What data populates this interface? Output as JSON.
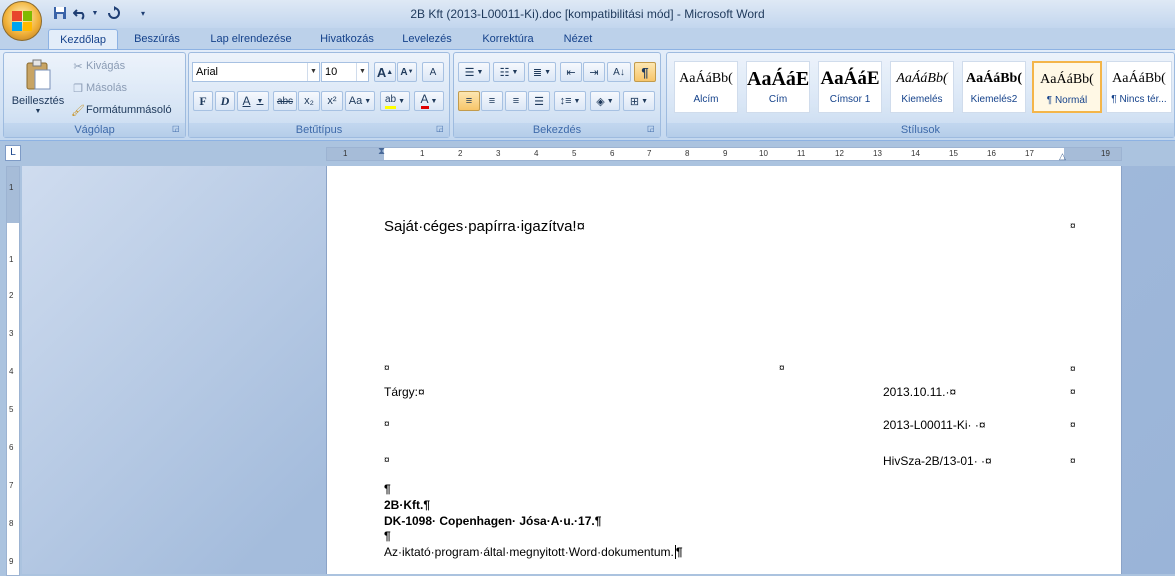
{
  "window": {
    "title": "2B Kft  (2013-L00011-Ki).doc [kompatibilitási mód] - Microsoft Word"
  },
  "qat": {
    "save_icon": "save-icon",
    "undo_icon": "undo-icon",
    "redo_icon": "redo-icon",
    "dropdown_icon": "chevron-down-icon"
  },
  "tabs": [
    {
      "label": "Kezdőlap",
      "active": true
    },
    {
      "label": "Beszúrás"
    },
    {
      "label": "Lap elrendezése"
    },
    {
      "label": "Hivatkozás"
    },
    {
      "label": "Levelezés"
    },
    {
      "label": "Korrektúra"
    },
    {
      "label": "Nézet"
    }
  ],
  "clipboard": {
    "paste": "Beillesztés",
    "cut": "Kivágás",
    "copy": "Másolás",
    "format_painter": "Formátummásoló",
    "group": "Vágólap"
  },
  "font": {
    "name": "Arial",
    "size": "10",
    "grow": "A",
    "shrink": "A",
    "clear": "A",
    "bold": "F",
    "italic": "D",
    "underline": "A",
    "strike": "abc",
    "sub": "x₂",
    "sup": "x²",
    "case": "Aa",
    "highlight": "ab",
    "color": "A",
    "group": "Betűtípus"
  },
  "paragraph": {
    "group": "Bekezdés",
    "pilcrow": "¶"
  },
  "styles": {
    "group": "Stílusok",
    "items": [
      {
        "preview": "AaÁáBb(",
        "name": "Alcím"
      },
      {
        "preview": "AaÁáE",
        "name": "Cím"
      },
      {
        "preview": "AaÁáE",
        "name": "Címsor 1"
      },
      {
        "preview": "AaÁáBb(",
        "name": "Kiemelés"
      },
      {
        "preview": "AaÁáBb(",
        "name": "Kiemelés2"
      },
      {
        "preview": "AaÁáBb(",
        "name": "¶ Normál",
        "selected": true
      },
      {
        "preview": "AaÁáBb(",
        "name": "¶ Nincs tér..."
      }
    ]
  },
  "ruler": {
    "numbers": [
      "1",
      "1",
      "2",
      "3",
      "4",
      "5",
      "6",
      "7",
      "8",
      "9",
      "10",
      "11",
      "12",
      "13",
      "14",
      "15",
      "16",
      "17",
      "19"
    ],
    "vnumbers": [
      "1",
      "1",
      "2",
      "3",
      "4",
      "5",
      "6",
      "7",
      "8",
      "9"
    ],
    "tab_stop_icon": "tab-stop-icon"
  },
  "document": {
    "header_line": "Saját·céges·papírra·igazítva!¤",
    "cell_mark": "¤",
    "subject_label": "Tárgy:¤",
    "date": "2013.10.11.·¤",
    "file_no": "2013-L00011-Ki·  ·¤",
    "ref_no": "HivSza-2B/13-01·  ·¤",
    "pilcrow": "¶",
    "company": "2B·Kft.¶",
    "address": "DK-1098· Copenhagen· Jósa·A·u.·17.¶",
    "body": "Az·iktató·program·által·megnyitott·Word·dokumentum.",
    "body_end": "¶"
  }
}
